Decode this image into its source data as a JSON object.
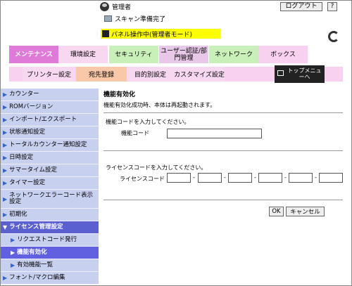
{
  "header": {
    "user_label": "管理者",
    "logout_label": "ログアウト",
    "help_label": "?",
    "scan_status": "スキャン準備完了",
    "panel_status": "パネル操作中(管理者モード)"
  },
  "tabs": [
    "メンテナンス",
    "環境設定",
    "セキュリティ",
    "ユーザー認証/部門管理",
    "ネットワーク",
    "ボックス"
  ],
  "subtabs": [
    "プリンター設定",
    "宛先登録",
    "目的別設定",
    "カスタマイズ設定"
  ],
  "topmenu_label": "トップメニューへ",
  "sidebar": {
    "items": [
      "カウンター",
      "ROMバージョン",
      "インポート/エクスポート",
      "状態通知設定",
      "トータルカウンター通知設定",
      "日時設定",
      "サマータイム設定",
      "タイマー設定",
      "ネットワークエラーコード表示設定",
      "初期化",
      "ライセンス管理設定",
      "リクエストコード発行",
      "機能有効化",
      "有効機能一覧",
      "フォント/マクロ編集"
    ]
  },
  "main": {
    "title": "機能有効化",
    "description": "機能有効化成功時、本体は再起動されます。",
    "function_code_prompt": "機能コードを入力してください。",
    "function_code_label": "機能コード",
    "function_code_value": "",
    "license_code_prompt": "ライセンスコードを入力してください。",
    "license_code_label": "ライセンスコード",
    "dash": "-",
    "ok_label": "OK",
    "cancel_label": "キャンセル"
  }
}
